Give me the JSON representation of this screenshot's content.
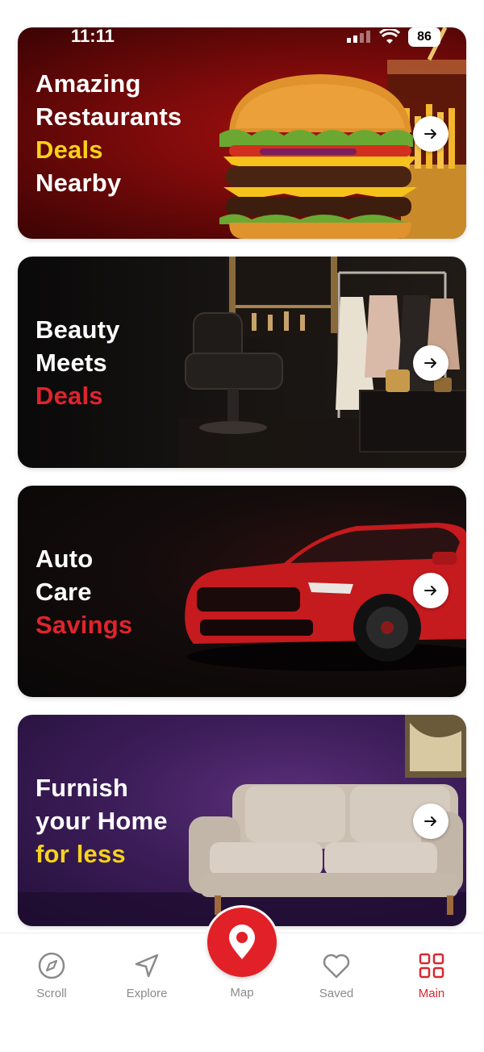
{
  "status_bar": {
    "time": "11:11",
    "battery": "86"
  },
  "cards": [
    {
      "lines": [
        "Amazing",
        "Restaurants",
        "Deals",
        "Nearby"
      ],
      "highlight_line": "Deals",
      "highlight_color": "#f7d21c",
      "icon": "arrow-right-icon"
    },
    {
      "lines": [
        "Beauty",
        "Meets",
        "Deals"
      ],
      "highlight_line": "Deals",
      "highlight_color": "#e0242c",
      "icon": "arrow-right-icon"
    },
    {
      "lines": [
        "Auto",
        "Care",
        "Savings"
      ],
      "highlight_line": "Savings",
      "highlight_color": "#e0242c",
      "icon": "arrow-right-icon"
    },
    {
      "lines": [
        "Furnish",
        "your Home",
        "for less"
      ],
      "highlight_line": "for less",
      "highlight_color": "#f7d21c",
      "icon": "arrow-right-icon"
    }
  ],
  "bottom_nav": {
    "items": [
      {
        "label": "Scroll",
        "icon": "compass-icon",
        "active": false
      },
      {
        "label": "Explore",
        "icon": "navigation-arrow-icon",
        "active": false
      },
      {
        "label": "Map",
        "icon": "map-pin-icon",
        "active": false
      },
      {
        "label": "Saved",
        "icon": "heart-icon",
        "active": false
      },
      {
        "label": "Main",
        "icon": "grid-icon",
        "active": true
      }
    ]
  },
  "colors": {
    "brand_red": "#e22027",
    "active_label": "#d7282f",
    "inactive_label": "#8a8a8a"
  }
}
